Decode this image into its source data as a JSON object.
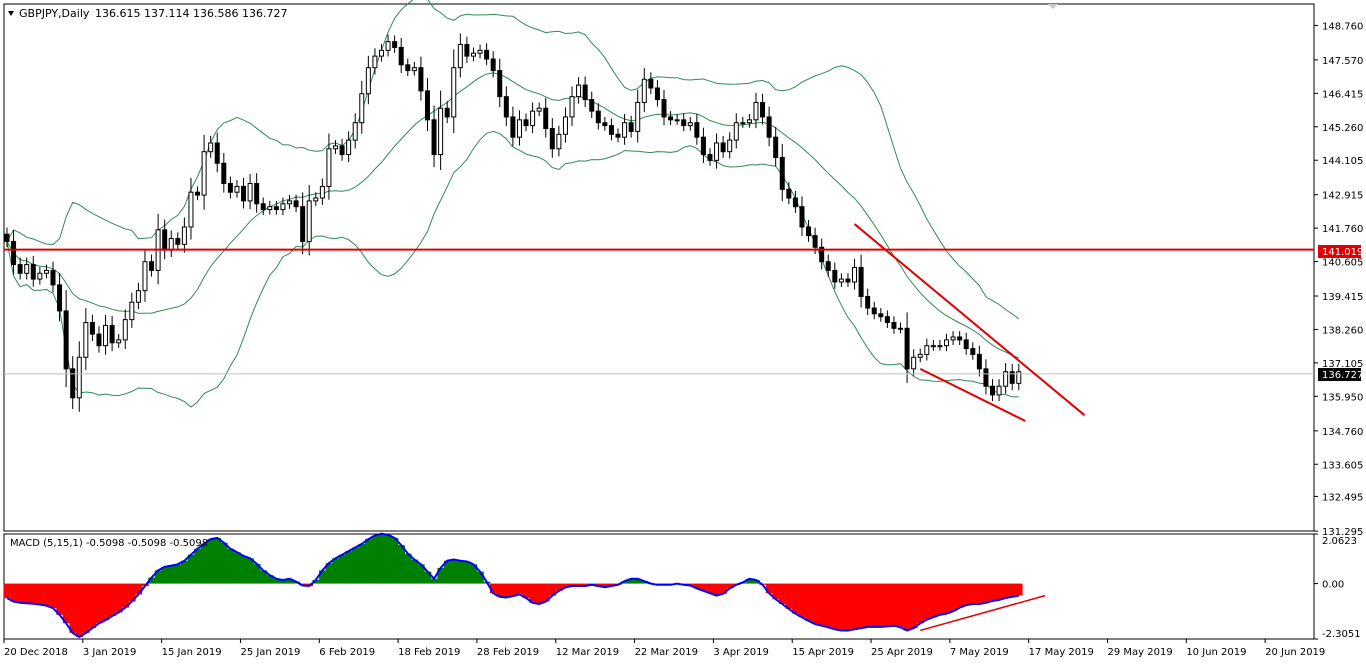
{
  "header": {
    "symbol_label": "GBPJPY,Daily",
    "ohlc_label": "136.615 137.114 136.586 136.727"
  },
  "macd_label": "MACD (5,15,1) -0.5098 -0.5098 -0.5098",
  "price_levels": {
    "hline": "141.019",
    "current": "136.727"
  },
  "colors": {
    "candle": "#000000",
    "bands": "#2e8b57",
    "hline": "#e00000",
    "trendlines": "#e00000",
    "macd_positive": "#008000",
    "macd_negative": "#ff0000",
    "macd_signal": "#0000ff",
    "grid_current": "#c0c0c0"
  },
  "chart_data": [
    {
      "type": "candlestick",
      "title": "GBPJPY,Daily",
      "ylim": [
        131.3,
        149.5
      ],
      "y_ticks": [
        "148.760",
        "147.570",
        "146.415",
        "145.260",
        "144.105",
        "142.915",
        "141.760",
        "140.605",
        "139.415",
        "138.260",
        "137.105",
        "135.950",
        "134.760",
        "133.605",
        "132.495",
        "131.295"
      ],
      "x_labels": [
        "20 Dec 2018",
        "3 Jan 2019",
        "15 Jan 2019",
        "25 Jan 2019",
        "6 Feb 2019",
        "18 Feb 2019",
        "28 Feb 2019",
        "12 Mar 2019",
        "22 Mar 2019",
        "3 Apr 2019",
        "15 Apr 2019",
        "25 Apr 2019",
        "7 May 2019",
        "17 May 2019",
        "29 May 2019",
        "10 Jun 2019",
        "20 Jun 2019"
      ],
      "close": [
        141.3,
        140.5,
        140.2,
        140.5,
        140.0,
        140.2,
        140.3,
        139.8,
        138.9,
        136.9,
        135.9,
        137.3,
        138.5,
        138.1,
        137.7,
        138.4,
        137.8,
        137.9,
        138.6,
        139.2,
        139.6,
        140.6,
        140.3,
        141.7,
        141.0,
        141.4,
        141.2,
        141.8,
        143.0,
        142.9,
        144.4,
        144.7,
        144.0,
        143.3,
        143.0,
        143.2,
        142.7,
        143.3,
        142.6,
        142.4,
        142.5,
        142.4,
        142.6,
        142.7,
        142.5,
        141.3,
        142.7,
        142.8,
        143.2,
        144.5,
        144.6,
        144.3,
        144.8,
        145.4,
        146.4,
        147.3,
        147.7,
        147.9,
        148.2,
        148.0,
        147.4,
        147.2,
        147.3,
        146.5,
        145.5,
        144.3,
        145.9,
        145.6,
        147.3,
        148.1,
        147.7,
        147.8,
        147.9,
        147.6,
        147.2,
        146.3,
        145.6,
        144.9,
        145.5,
        145.3,
        145.8,
        145.9,
        145.2,
        144.5,
        145.0,
        145.6,
        146.3,
        146.7,
        146.2,
        145.8,
        145.4,
        145.3,
        145.0,
        144.9,
        145.4,
        145.1,
        146.1,
        146.9,
        146.6,
        146.2,
        145.6,
        145.5,
        145.5,
        145.3,
        145.4,
        144.9,
        144.3,
        144.1,
        144.7,
        144.4,
        144.8,
        145.4,
        145.4,
        145.5,
        146.1,
        145.6,
        144.9,
        144.2,
        143.1,
        142.8,
        142.5,
        141.8,
        141.5,
        141.1,
        140.6,
        140.3,
        139.9,
        140.0,
        139.9,
        140.4,
        139.4,
        139.0,
        138.8,
        138.7,
        138.5,
        138.3,
        138.3,
        136.9,
        137.3,
        137.4,
        137.7,
        137.7,
        137.7,
        137.9,
        138.0,
        137.9,
        137.6,
        137.4,
        136.9,
        136.3,
        136.0,
        136.3,
        136.8,
        136.4,
        136.8
      ]
    },
    {
      "type": "area",
      "title": "MACD (5,15,1) -0.5098 -0.5098 -0.5098",
      "ylim": [
        -2.3051,
        2.0623
      ],
      "y_ticks": [
        "2.0623",
        "0.00",
        "-2.3051"
      ],
      "series": [
        {
          "values": [
            -0.6,
            -0.75,
            -0.8,
            -0.82,
            -0.84,
            -0.87,
            -0.92,
            -1.02,
            -1.3,
            -1.65,
            -2.05,
            -2.22,
            -2.05,
            -1.85,
            -1.65,
            -1.52,
            -1.35,
            -1.2,
            -1.0,
            -0.75,
            -0.45,
            -0.1,
            0.25,
            0.55,
            0.7,
            0.75,
            0.8,
            0.95,
            1.2,
            1.45,
            1.65,
            1.85,
            1.9,
            1.7,
            1.45,
            1.3,
            1.15,
            1.05,
            0.82,
            0.55,
            0.35,
            0.2,
            0.15,
            0.2,
            0.08,
            -0.08,
            -0.1,
            0.15,
            0.55,
            0.85,
            1.05,
            1.2,
            1.35,
            1.5,
            1.65,
            1.85,
            2.0,
            2.08,
            2.02,
            1.9,
            1.6,
            1.25,
            1.0,
            0.8,
            0.5,
            0.2,
            0.65,
            0.95,
            1.0,
            0.95,
            0.92,
            0.8,
            0.5,
            0.08,
            -0.4,
            -0.55,
            -0.58,
            -0.52,
            -0.45,
            -0.6,
            -0.8,
            -0.85,
            -0.75,
            -0.5,
            -0.3,
            -0.16,
            -0.1,
            -0.1,
            -0.1,
            -0.05,
            -0.1,
            -0.15,
            -0.1,
            -0.05,
            0.1,
            0.2,
            0.2,
            0.1,
            0.0,
            -0.05,
            -0.05,
            -0.05,
            0.0,
            -0.05,
            -0.08,
            -0.2,
            -0.3,
            -0.4,
            -0.5,
            -0.42,
            -0.2,
            -0.05,
            0.05,
            0.2,
            0.15,
            -0.05,
            -0.4,
            -0.65,
            -0.85,
            -1.05,
            -1.25,
            -1.4,
            -1.55,
            -1.68,
            -1.75,
            -1.82,
            -1.9,
            -1.95,
            -1.95,
            -1.9,
            -1.85,
            -1.8,
            -1.8,
            -1.8,
            -1.78,
            -1.75,
            -1.82,
            -1.95,
            -1.85,
            -1.65,
            -1.5,
            -1.4,
            -1.3,
            -1.25,
            -1.15,
            -1.0,
            -0.9,
            -0.85,
            -0.85,
            -0.8,
            -0.72,
            -0.68,
            -0.6,
            -0.55,
            -0.5
          ]
        }
      ]
    }
  ]
}
